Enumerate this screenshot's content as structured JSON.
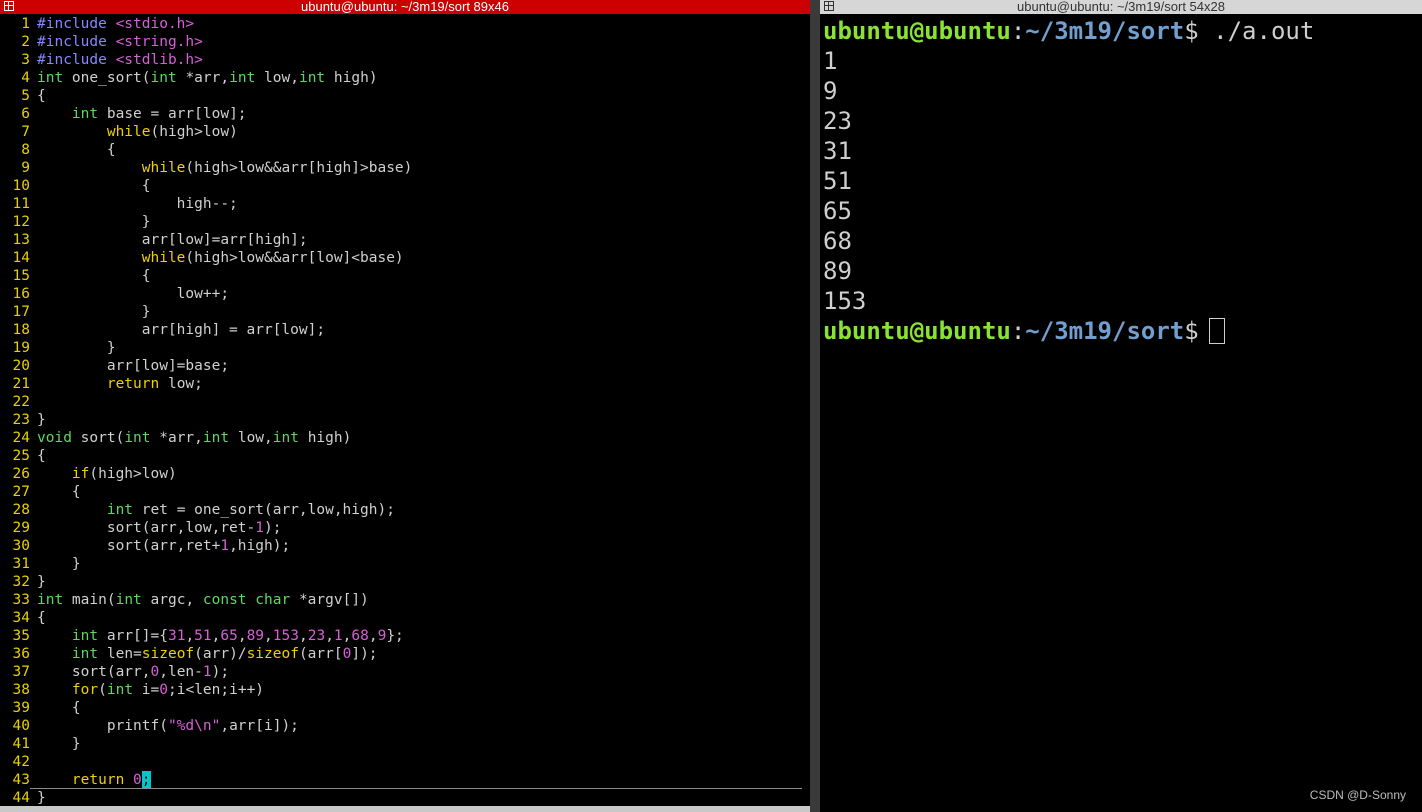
{
  "left_window": {
    "title": "ubuntu@ubuntu: ~/3m19/sort 89x46",
    "code_lines": [
      [
        {
          "t": "#include ",
          "c": "p"
        },
        {
          "t": "<stdio.h>",
          "c": "s"
        }
      ],
      [
        {
          "t": "#include ",
          "c": "p"
        },
        {
          "t": "<string.h>",
          "c": "s"
        }
      ],
      [
        {
          "t": "#include ",
          "c": "p"
        },
        {
          "t": "<stdlib.h>",
          "c": "s"
        }
      ],
      [
        {
          "t": "int",
          "c": "t"
        },
        {
          "t": " one_sort(",
          "c": ""
        },
        {
          "t": "int",
          "c": "t"
        },
        {
          "t": " *arr,",
          "c": ""
        },
        {
          "t": "int",
          "c": "t"
        },
        {
          "t": " low,",
          "c": ""
        },
        {
          "t": "int",
          "c": "t"
        },
        {
          "t": " high)",
          "c": ""
        }
      ],
      [
        {
          "t": "{",
          "c": ""
        }
      ],
      [
        {
          "t": "    ",
          "c": ""
        },
        {
          "t": "int",
          "c": "t"
        },
        {
          "t": " base = arr[low];",
          "c": ""
        }
      ],
      [
        {
          "t": "        ",
          "c": ""
        },
        {
          "t": "while",
          "c": "k"
        },
        {
          "t": "(high>low)",
          "c": ""
        }
      ],
      [
        {
          "t": "        {",
          "c": ""
        }
      ],
      [
        {
          "t": "            ",
          "c": ""
        },
        {
          "t": "while",
          "c": "k"
        },
        {
          "t": "(high>low&&arr[high]>base)",
          "c": ""
        }
      ],
      [
        {
          "t": "            {",
          "c": ""
        }
      ],
      [
        {
          "t": "                high--;",
          "c": ""
        }
      ],
      [
        {
          "t": "            }",
          "c": ""
        }
      ],
      [
        {
          "t": "            arr[low]=arr[high];",
          "c": ""
        }
      ],
      [
        {
          "t": "            ",
          "c": ""
        },
        {
          "t": "while",
          "c": "k"
        },
        {
          "t": "(high>low&&arr[low]<base)",
          "c": ""
        }
      ],
      [
        {
          "t": "            {",
          "c": ""
        }
      ],
      [
        {
          "t": "                low++;",
          "c": ""
        }
      ],
      [
        {
          "t": "            }",
          "c": ""
        }
      ],
      [
        {
          "t": "            arr[high] = arr[low];",
          "c": ""
        }
      ],
      [
        {
          "t": "        }",
          "c": ""
        }
      ],
      [
        {
          "t": "        arr[low]=base;",
          "c": ""
        }
      ],
      [
        {
          "t": "        ",
          "c": ""
        },
        {
          "t": "return",
          "c": "k"
        },
        {
          "t": " low;",
          "c": ""
        }
      ],
      [],
      [
        {
          "t": "}",
          "c": ""
        }
      ],
      [
        {
          "t": "void",
          "c": "t"
        },
        {
          "t": " sort(",
          "c": ""
        },
        {
          "t": "int",
          "c": "t"
        },
        {
          "t": " *arr,",
          "c": ""
        },
        {
          "t": "int",
          "c": "t"
        },
        {
          "t": " low,",
          "c": ""
        },
        {
          "t": "int",
          "c": "t"
        },
        {
          "t": " high)",
          "c": ""
        }
      ],
      [
        {
          "t": "{",
          "c": ""
        }
      ],
      [
        {
          "t": "    ",
          "c": ""
        },
        {
          "t": "if",
          "c": "k"
        },
        {
          "t": "(high>low)",
          "c": ""
        }
      ],
      [
        {
          "t": "    {",
          "c": ""
        }
      ],
      [
        {
          "t": "        ",
          "c": ""
        },
        {
          "t": "int",
          "c": "t"
        },
        {
          "t": " ret = one_sort(arr,low,high);",
          "c": ""
        }
      ],
      [
        {
          "t": "        sort(arr,low,ret-",
          "c": ""
        },
        {
          "t": "1",
          "c": "n"
        },
        {
          "t": ");",
          "c": ""
        }
      ],
      [
        {
          "t": "        sort(arr,ret+",
          "c": ""
        },
        {
          "t": "1",
          "c": "n"
        },
        {
          "t": ",high);",
          "c": ""
        }
      ],
      [
        {
          "t": "    }",
          "c": ""
        }
      ],
      [
        {
          "t": "}",
          "c": ""
        }
      ],
      [
        {
          "t": "int",
          "c": "t"
        },
        {
          "t": " main(",
          "c": ""
        },
        {
          "t": "int",
          "c": "t"
        },
        {
          "t": " argc, ",
          "c": ""
        },
        {
          "t": "const",
          "c": "t"
        },
        {
          "t": " ",
          "c": ""
        },
        {
          "t": "char",
          "c": "t"
        },
        {
          "t": " *argv[])",
          "c": ""
        }
      ],
      [
        {
          "t": "{",
          "c": ""
        }
      ],
      [
        {
          "t": "    ",
          "c": ""
        },
        {
          "t": "int",
          "c": "t"
        },
        {
          "t": " arr[]={",
          "c": ""
        },
        {
          "t": "31",
          "c": "n"
        },
        {
          "t": ",",
          "c": ""
        },
        {
          "t": "51",
          "c": "n"
        },
        {
          "t": ",",
          "c": ""
        },
        {
          "t": "65",
          "c": "n"
        },
        {
          "t": ",",
          "c": ""
        },
        {
          "t": "89",
          "c": "n"
        },
        {
          "t": ",",
          "c": ""
        },
        {
          "t": "153",
          "c": "n"
        },
        {
          "t": ",",
          "c": ""
        },
        {
          "t": "23",
          "c": "n"
        },
        {
          "t": ",",
          "c": ""
        },
        {
          "t": "1",
          "c": "n"
        },
        {
          "t": ",",
          "c": ""
        },
        {
          "t": "68",
          "c": "n"
        },
        {
          "t": ",",
          "c": ""
        },
        {
          "t": "9",
          "c": "n"
        },
        {
          "t": "};",
          "c": ""
        }
      ],
      [
        {
          "t": "    ",
          "c": ""
        },
        {
          "t": "int",
          "c": "t"
        },
        {
          "t": " len=",
          "c": ""
        },
        {
          "t": "sizeof",
          "c": "k"
        },
        {
          "t": "(arr)/",
          "c": ""
        },
        {
          "t": "sizeof",
          "c": "k"
        },
        {
          "t": "(arr[",
          "c": ""
        },
        {
          "t": "0",
          "c": "n"
        },
        {
          "t": "]);",
          "c": ""
        }
      ],
      [
        {
          "t": "    sort(arr,",
          "c": ""
        },
        {
          "t": "0",
          "c": "n"
        },
        {
          "t": ",len-",
          "c": ""
        },
        {
          "t": "1",
          "c": "n"
        },
        {
          "t": ");",
          "c": ""
        }
      ],
      [
        {
          "t": "    ",
          "c": ""
        },
        {
          "t": "for",
          "c": "k"
        },
        {
          "t": "(",
          "c": ""
        },
        {
          "t": "int",
          "c": "t"
        },
        {
          "t": " i=",
          "c": ""
        },
        {
          "t": "0",
          "c": "n"
        },
        {
          "t": ";i<len;i++)",
          "c": ""
        }
      ],
      [
        {
          "t": "    {",
          "c": ""
        }
      ],
      [
        {
          "t": "        printf(",
          "c": ""
        },
        {
          "t": "\"%d\\n\"",
          "c": "s"
        },
        {
          "t": ",arr[i]);",
          "c": ""
        }
      ],
      [
        {
          "t": "    }",
          "c": ""
        }
      ],
      [],
      [
        {
          "t": "    ",
          "c": ""
        },
        {
          "t": "return",
          "c": "k"
        },
        {
          "t": " ",
          "c": ""
        },
        {
          "t": "0",
          "c": "n"
        },
        {
          "t": ";",
          "c": "cursor"
        }
      ],
      [
        {
          "t": "}",
          "c": ""
        }
      ]
    ]
  },
  "right_window": {
    "title": "ubuntu@ubuntu: ~/3m19/sort 54x28",
    "prompt_user": "ubuntu@ubuntu",
    "prompt_sep": ":",
    "prompt_path": "~/3m19/sort",
    "prompt_symbol": "$",
    "command": "./a.out",
    "output_lines": [
      "1",
      "9",
      "23",
      "31",
      "51",
      "65",
      "68",
      "89",
      "153"
    ]
  },
  "watermark": "CSDN @D-Sonny",
  "colors": {
    "active_titlebar": "#cc0000",
    "inactive_titlebar": "#d6d6d6",
    "prompt_user": "#8ae234",
    "prompt_path": "#729fcf",
    "line_numbers": "#e8d000",
    "cursor": "#00c8c8"
  }
}
